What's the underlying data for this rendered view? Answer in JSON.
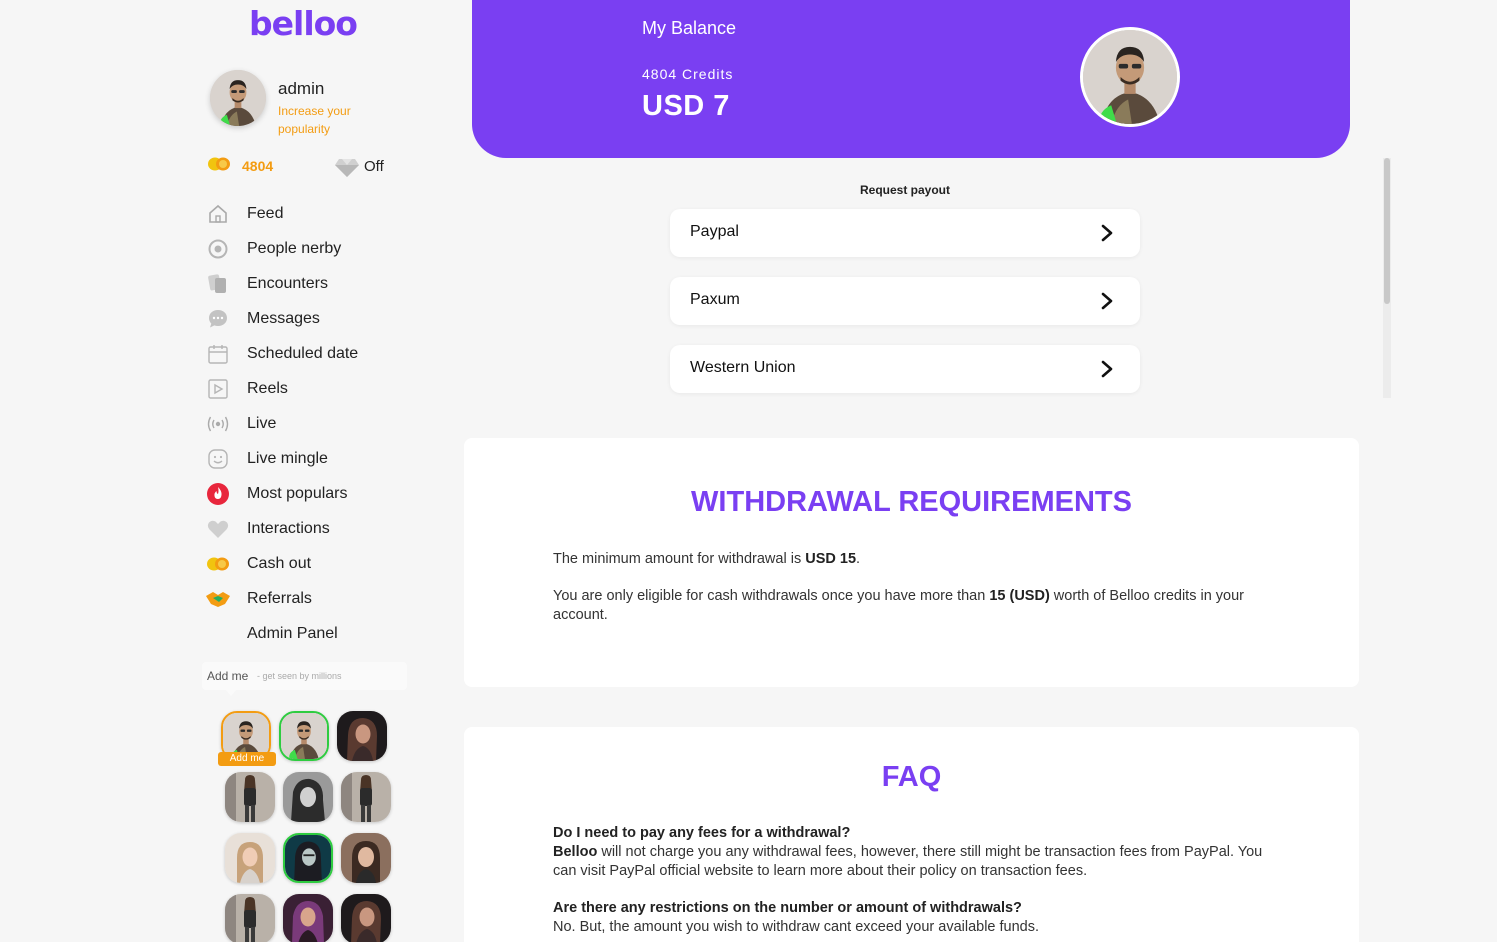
{
  "app": {
    "logo": "belloo"
  },
  "profile": {
    "name": "admin",
    "subtitle": "Increase your popularity",
    "credits": "4804",
    "vip": "Off"
  },
  "nav": [
    {
      "label": "Feed",
      "icon": "home-icon"
    },
    {
      "label": "People nerby",
      "icon": "radar-icon"
    },
    {
      "label": "Encounters",
      "icon": "cards-icon"
    },
    {
      "label": "Messages",
      "icon": "chat-icon"
    },
    {
      "label": "Scheduled date",
      "icon": "calendar-icon"
    },
    {
      "label": "Reels",
      "icon": "play-icon"
    },
    {
      "label": "Live",
      "icon": "broadcast-icon"
    },
    {
      "label": "Live mingle",
      "icon": "smile-icon"
    },
    {
      "label": "Most populars",
      "icon": "fire-icon"
    },
    {
      "label": "Interactions",
      "icon": "heart-icon"
    },
    {
      "label": "Cash out",
      "icon": "coins-icon"
    },
    {
      "label": "Referrals",
      "icon": "handshake-icon"
    },
    {
      "label": "Admin Panel",
      "icon": ""
    }
  ],
  "addme": {
    "label": "Add me",
    "hint": "- get seen by millions",
    "tag": "Add me"
  },
  "balance": {
    "title": "My Balance",
    "credits": "4804 Credits",
    "amount": "USD 7"
  },
  "payout": {
    "title": "Request payout",
    "methods": [
      "Paypal",
      "Paxum",
      "Western Union"
    ]
  },
  "requirements": {
    "title": "WITHDRAWAL REQUIREMENTS",
    "p1_a": "The minimum amount for withdrawal is ",
    "p1_b": "USD 15",
    "p1_c": ".",
    "p2_a": "You are only eligible for cash withdrawals once you have more than ",
    "p2_b": "15 (USD)",
    "p2_c": " worth of Belloo credits in your account."
  },
  "faq": {
    "title": "FAQ",
    "q1": "Do I need to pay any fees for a withdrawal?",
    "a1_b": "Belloo",
    "a1": " will not charge you any withdrawal fees, however, there still might be transaction fees from PayPal. You can visit PayPal official website to learn more about their policy on transaction fees.",
    "q2": "Are there any restrictions on the number or amount of withdrawals?",
    "a2": "No. But, the amount you wish to withdraw cant exceed your available funds."
  },
  "colors": {
    "brand": "#7a3ff2",
    "accent": "#f39c12",
    "online": "#2ecc40",
    "background": "#f6f6f6"
  }
}
